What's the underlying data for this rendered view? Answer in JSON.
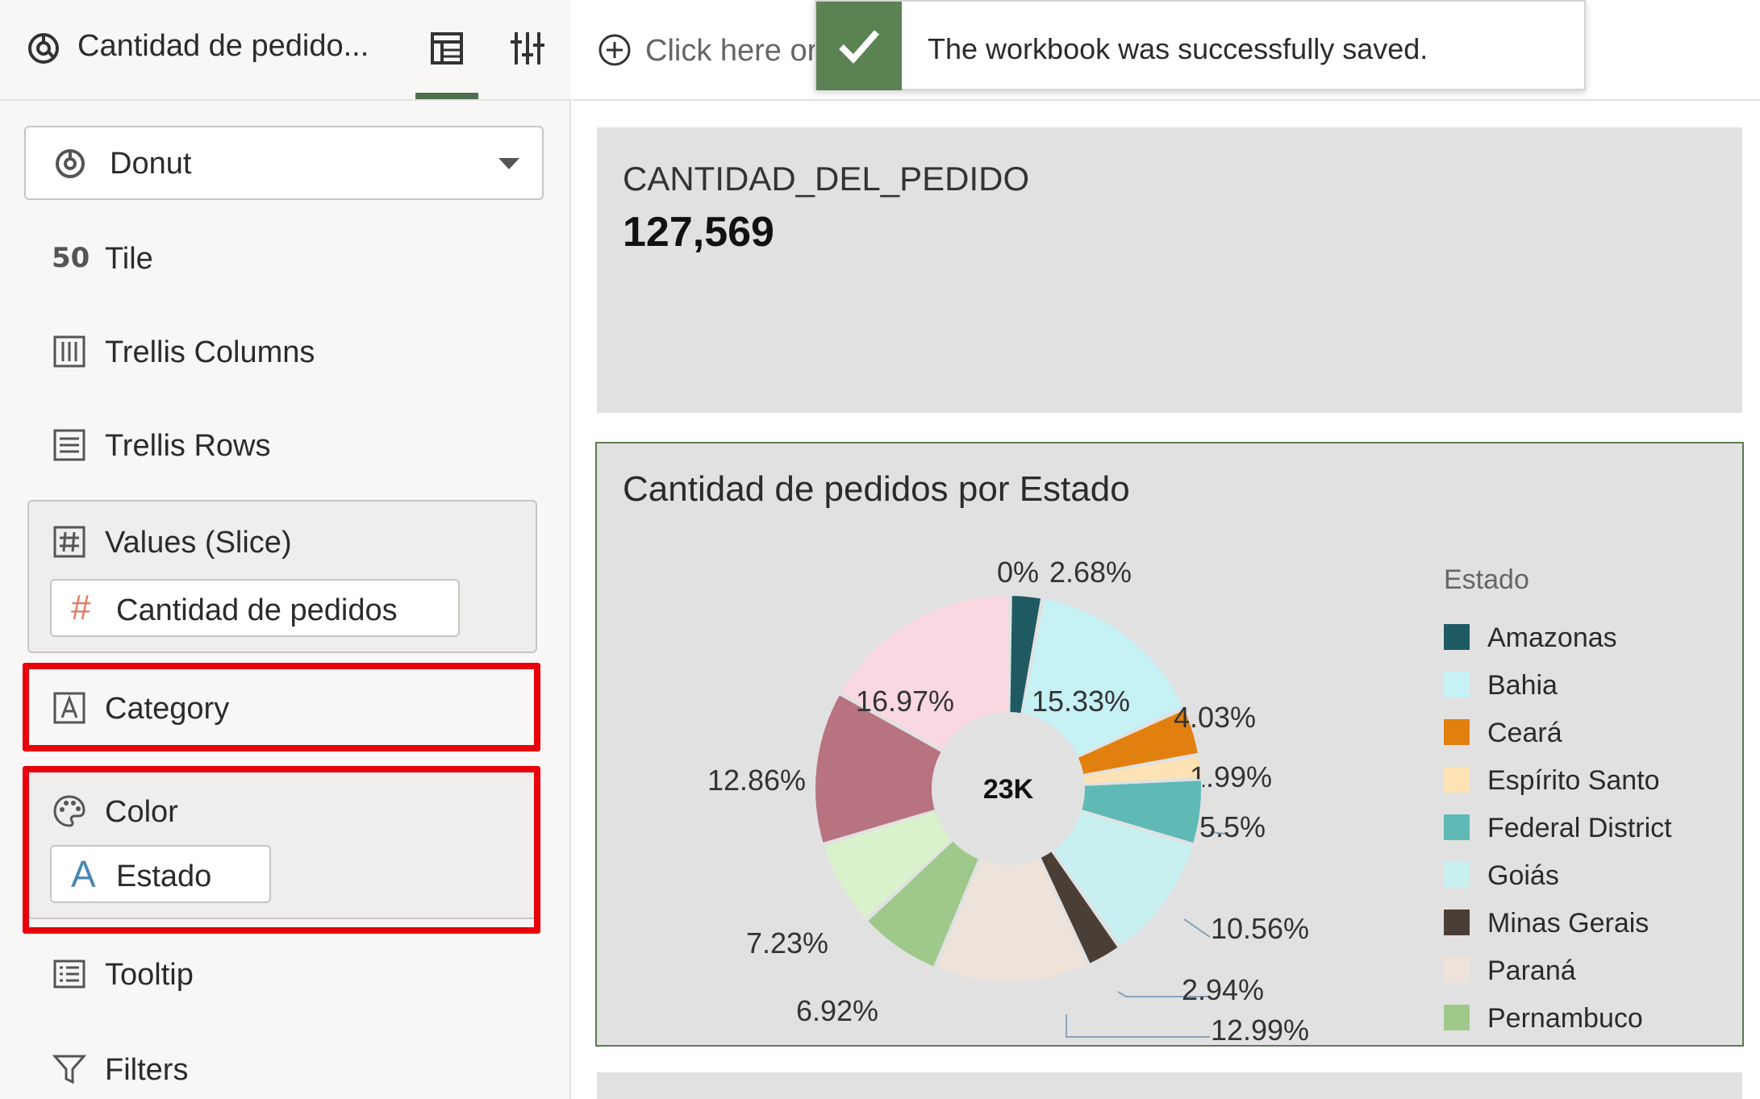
{
  "panel": {
    "title": "Cantidad de pedido...",
    "viz_type": "Donut",
    "grammar": {
      "tile": "Tile",
      "tile_glyph": "50",
      "trellis_columns": "Trellis Columns",
      "trellis_rows": "Trellis Rows",
      "values_slice": "Values (Slice)",
      "values_pill": "Cantidad de pedidos",
      "category": "Category",
      "color": "Color",
      "color_pill": "Estado",
      "tooltip": "Tooltip",
      "filters": "Filters"
    }
  },
  "canvas": {
    "add_text": "Click here or"
  },
  "toast": {
    "message": "The workbook was successfully saved."
  },
  "tile": {
    "label": "CANTIDAD_DEL_PEDIDO",
    "value": "127,569"
  },
  "donut": {
    "title": "Cantidad de pedidos por Estado",
    "legend_title": "Estado"
  },
  "colors": {
    "accent_green": "#5b8253",
    "selection_red": "#e8000b"
  },
  "chart_data": {
    "type": "pie",
    "title": "Cantidad de pedidos por Estado",
    "center_label": "23K",
    "legend_title": "Estado",
    "legend_placement": "right",
    "slices": [
      {
        "name": "Amazonas",
        "value": 2.68,
        "label": "2.68%",
        "color": "#1f5a63"
      },
      {
        "name": "Bahia",
        "value": 15.33,
        "label": "15.33%",
        "color": "#c6f1f5"
      },
      {
        "name": "Ceará",
        "value": 4.03,
        "label": "4.03%",
        "color": "#e2800f"
      },
      {
        "name": "Espírito Santo",
        "value": 1.99,
        "label": "1.99%",
        "color": "#fde2b3"
      },
      {
        "name": "Federal District",
        "value": 5.5,
        "label": "5.5%",
        "color": "#5fbab6"
      },
      {
        "name": "Goiás",
        "value": 10.56,
        "label": "10.56%",
        "color": "#c8f0f0"
      },
      {
        "name": "Minas Gerais",
        "value": 2.94,
        "label": "2.94%",
        "color": "#4a3f37"
      },
      {
        "name": "Paraná",
        "value": 12.99,
        "label": "12.99%",
        "color": "#ede3db"
      },
      {
        "name": "Pernambuco",
        "value": 6.92,
        "label": "6.92%",
        "color": "#9ec98a"
      },
      {
        "name": "",
        "value": 7.23,
        "label": "7.23%",
        "color": "#d9f2cc"
      },
      {
        "name": "",
        "value": 12.86,
        "label": "12.86%",
        "color": "#b87381"
      },
      {
        "name": "",
        "value": 16.97,
        "label": "16.97%",
        "color": "#f9d8e2"
      },
      {
        "name": "",
        "value": 0,
        "label": "0%",
        "color": "#999999"
      }
    ]
  }
}
